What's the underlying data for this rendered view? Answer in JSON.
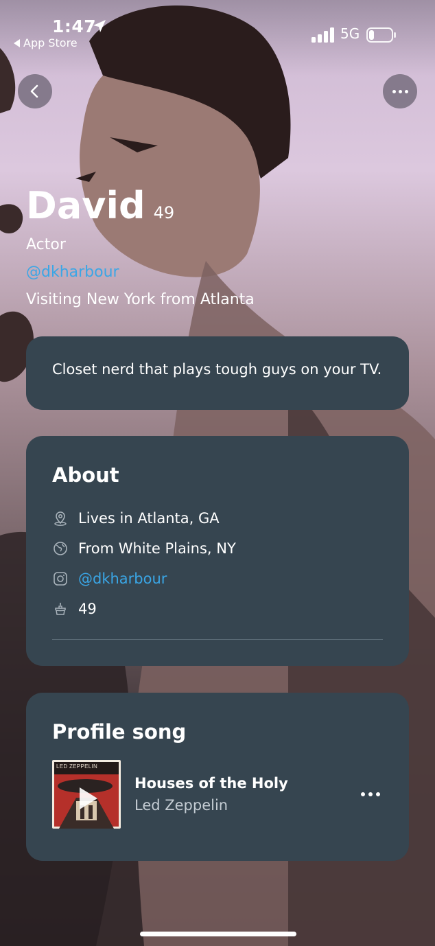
{
  "status_bar": {
    "time": "1:47",
    "back_app": "App Store",
    "network": "5G"
  },
  "nav": {
    "back_icon": "chevron-left-icon",
    "more_icon": "more-horizontal-icon"
  },
  "profile": {
    "name": "David",
    "age": "49",
    "occupation": "Actor",
    "handle": "@dkharbour",
    "visiting": "Visiting New York from Atlanta",
    "bio": "Closet nerd that plays tough guys on your TV."
  },
  "about": {
    "title": "About",
    "items": [
      {
        "icon": "location-pin-icon",
        "text": "Lives in Atlanta, GA"
      },
      {
        "icon": "globe-icon",
        "text": "From White Plains, NY"
      },
      {
        "icon": "instagram-icon",
        "text": "@dkharbour"
      },
      {
        "icon": "birthday-cake-icon",
        "text": "49"
      }
    ]
  },
  "profile_song": {
    "title": "Profile song",
    "song": "Houses of the Holy",
    "artist": "Led Zeppelin",
    "album_art_text": "LED ZEPPELIN"
  },
  "colors": {
    "card": "#364550",
    "link": "#3aa6e6",
    "bg_top": "#d9c6dd"
  }
}
